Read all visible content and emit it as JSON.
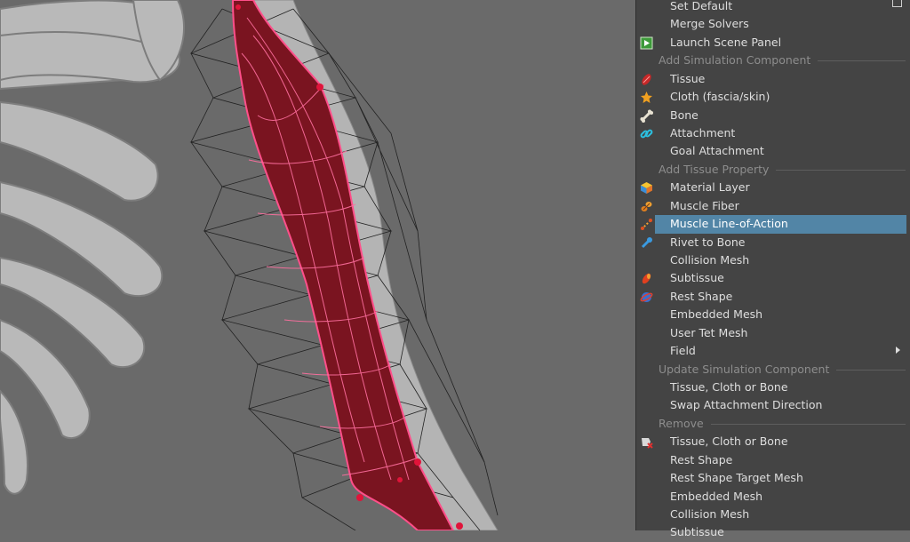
{
  "menu": {
    "items": [
      {
        "kind": "item",
        "label": "Set Default",
        "icon": "none",
        "checkbox": true
      },
      {
        "kind": "item",
        "label": "Merge Solvers",
        "icon": "none"
      },
      {
        "kind": "item",
        "label": "Launch Scene Panel",
        "icon": "scene-panel-icon"
      },
      {
        "kind": "section",
        "label": "Add Simulation Component"
      },
      {
        "kind": "item",
        "label": "Tissue",
        "icon": "tissue-icon"
      },
      {
        "kind": "item",
        "label": "Cloth (fascia/skin)",
        "icon": "cloth-icon"
      },
      {
        "kind": "item",
        "label": "Bone",
        "icon": "bone-icon"
      },
      {
        "kind": "item",
        "label": "Attachment",
        "icon": "attachment-icon"
      },
      {
        "kind": "item",
        "label": "Goal Attachment",
        "icon": "none"
      },
      {
        "kind": "section",
        "label": "Add Tissue Property"
      },
      {
        "kind": "item",
        "label": "Material Layer",
        "icon": "material-layer-icon"
      },
      {
        "kind": "item",
        "label": "Muscle Fiber",
        "icon": "muscle-fiber-icon"
      },
      {
        "kind": "item",
        "label": "Muscle Line-of-Action",
        "icon": "line-of-action-icon",
        "highlight": true
      },
      {
        "kind": "item",
        "label": "Rivet to Bone",
        "icon": "rivet-icon"
      },
      {
        "kind": "item",
        "label": "Collision Mesh",
        "icon": "none"
      },
      {
        "kind": "item",
        "label": "Subtissue",
        "icon": "subtissue-icon"
      },
      {
        "kind": "item",
        "label": "Rest Shape",
        "icon": "rest-shape-icon"
      },
      {
        "kind": "item",
        "label": "Embedded Mesh",
        "icon": "none"
      },
      {
        "kind": "item",
        "label": "User Tet Mesh",
        "icon": "none"
      },
      {
        "kind": "item",
        "label": "Field",
        "icon": "none",
        "submenu": true
      },
      {
        "kind": "section",
        "label": "Update Simulation Component"
      },
      {
        "kind": "item",
        "label": "Tissue, Cloth or Bone",
        "icon": "none"
      },
      {
        "kind": "item",
        "label": "Swap Attachment Direction",
        "icon": "none"
      },
      {
        "kind": "section",
        "label": "Remove"
      },
      {
        "kind": "item",
        "label": "Tissue, Cloth or Bone",
        "icon": "remove-icon"
      },
      {
        "kind": "item",
        "label": "Rest Shape",
        "icon": "none"
      },
      {
        "kind": "item",
        "label": "Rest Shape Target Mesh",
        "icon": "none"
      },
      {
        "kind": "item",
        "label": "Embedded Mesh",
        "icon": "none"
      },
      {
        "kind": "item",
        "label": "Collision Mesh",
        "icon": "none"
      },
      {
        "kind": "item",
        "label": "Subtissue",
        "icon": "none"
      }
    ]
  },
  "colors": {
    "menu_bg": "#444444",
    "highlight": "#5285a6",
    "muscle": "#7a1420",
    "muscle_wire": "#ff4f8a",
    "bone": "#b9b9b9",
    "viewport_bg": "#6a6a6a"
  }
}
